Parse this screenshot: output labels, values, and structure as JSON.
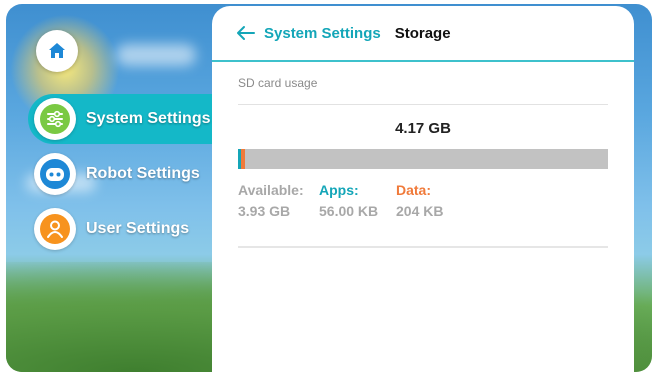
{
  "nav": {
    "items": [
      {
        "label": "System Settings",
        "icon": "sliders-icon",
        "color": "#7ac943"
      },
      {
        "label": "Robot Settings",
        "icon": "robot-icon",
        "color": "#1e88d6"
      },
      {
        "label": "User Settings",
        "icon": "user-icon",
        "color": "#f7931e"
      }
    ],
    "active_color": "#14b8c8"
  },
  "header": {
    "back_label": "System Settings",
    "current": "Storage"
  },
  "storage": {
    "section_label": "SD card usage",
    "total": "4.17 GB",
    "available_label": "Available:",
    "available_value": "3.93 GB",
    "apps_label": "Apps:",
    "apps_value": "56.00 KB",
    "data_label": "Data:",
    "data_value": "204 KB",
    "colors": {
      "apps": "#14a6b8",
      "data": "#f07a3a",
      "available": "#c2c2c2"
    },
    "usage_fraction": {
      "apps": 0.008,
      "data": 0.011
    }
  }
}
